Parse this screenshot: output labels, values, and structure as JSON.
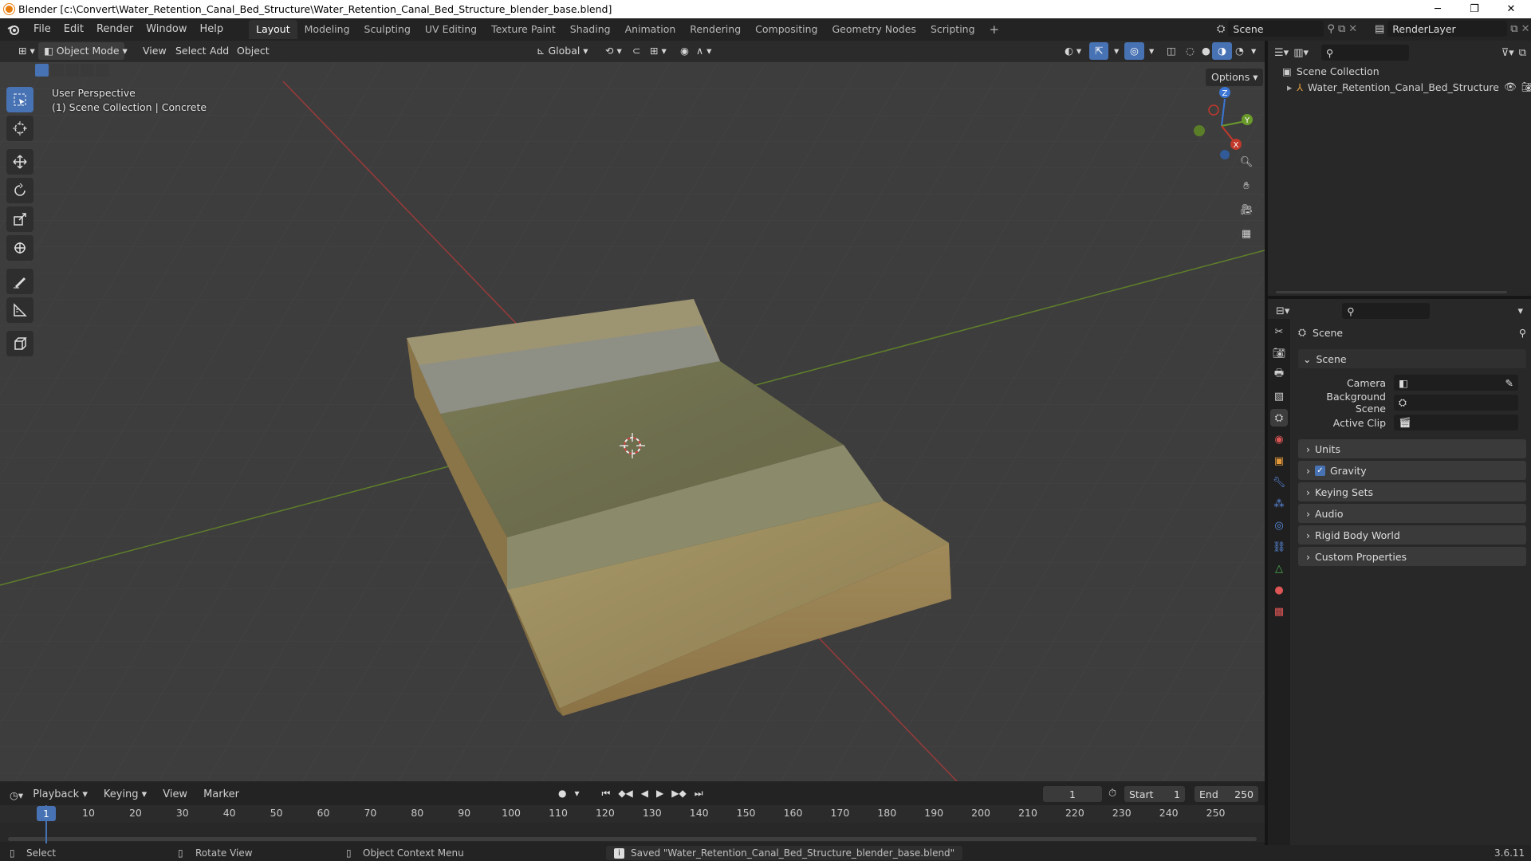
{
  "window": {
    "title": "Blender [c:\\Convert\\Water_Retention_Canal_Bed_Structure\\Water_Retention_Canal_Bed_Structure_blender_base.blend]",
    "minimize": "─",
    "maximize": "❐",
    "close": "✕"
  },
  "menu": {
    "items": [
      "File",
      "Edit",
      "Render",
      "Window",
      "Help"
    ]
  },
  "workspaces": {
    "tabs": [
      "Layout",
      "Modeling",
      "Sculpting",
      "UV Editing",
      "Texture Paint",
      "Shading",
      "Animation",
      "Rendering",
      "Compositing",
      "Geometry Nodes",
      "Scripting"
    ],
    "active": "Layout",
    "add": "+"
  },
  "scene_selector": {
    "value": "Scene"
  },
  "view_layer": {
    "value": "RenderLayer"
  },
  "viewport_header": {
    "mode": "Object Mode",
    "menus": [
      "View",
      "Select",
      "Add",
      "Object"
    ],
    "transform_orientation": "Global",
    "options": "Options"
  },
  "viewport": {
    "perspective": "User Perspective",
    "context": "(1) Scene Collection | Concrete",
    "gizmo": {
      "x": "X",
      "y": "Y",
      "z": "Z"
    }
  },
  "outliner": {
    "root": "Scene Collection",
    "items": [
      {
        "label": "Water_Retention_Canal_Bed_Structure"
      }
    ]
  },
  "properties": {
    "breadcrumb": "Scene",
    "section": "Scene",
    "fields": [
      {
        "label": "Camera",
        "value": ""
      },
      {
        "label": "Background Scene",
        "value": ""
      },
      {
        "label": "Active Clip",
        "value": ""
      }
    ],
    "panels": [
      "Units",
      "Gravity",
      "Keying Sets",
      "Audio",
      "Rigid Body World",
      "Custom Properties"
    ],
    "gravity_checked": true
  },
  "timeline": {
    "menus": [
      "Playback",
      "Keying",
      "View",
      "Marker"
    ],
    "current_frame": "1",
    "start_label": "Start",
    "start": "1",
    "end_label": "End",
    "end": "250",
    "ticks": [
      "10",
      "20",
      "30",
      "40",
      "50",
      "60",
      "70",
      "80",
      "90",
      "100",
      "110",
      "120",
      "130",
      "140",
      "150",
      "160",
      "170",
      "180",
      "190",
      "200",
      "210",
      "220",
      "230",
      "240",
      "250"
    ]
  },
  "statusbar": {
    "select": "Select",
    "rotate": "Rotate View",
    "context_menu": "Object Context Menu",
    "message": "Saved \"Water_Retention_Canal_Bed_Structure_blender_base.blend\"",
    "version": "3.6.11"
  },
  "colors": {
    "accent": "#4772b3",
    "x_axis": "#c0392b",
    "y_axis": "#6a9a2a",
    "z_axis": "#3b76d4",
    "timeline_cursor": "#4772b3"
  }
}
